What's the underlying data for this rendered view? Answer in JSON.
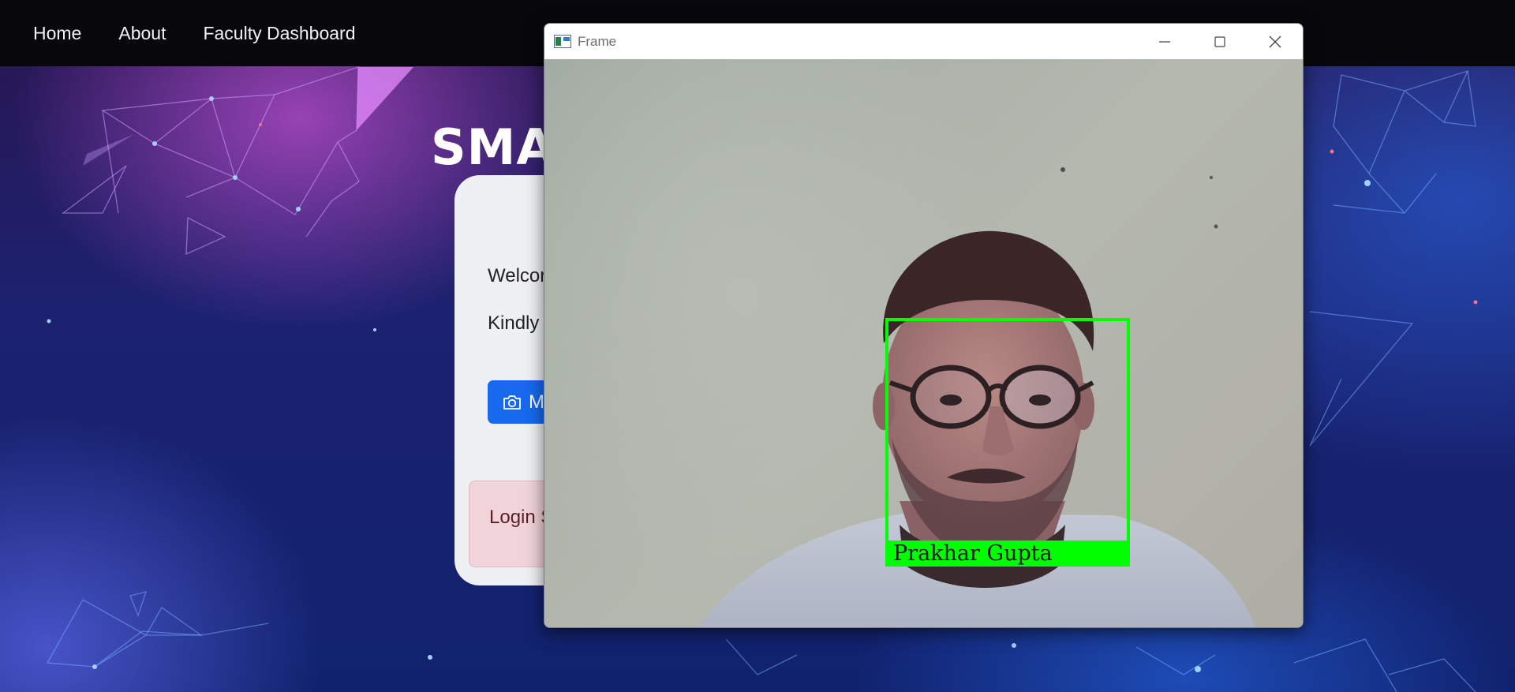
{
  "navbar": {
    "links": [
      "Home",
      "About",
      "Faculty Dashboard"
    ]
  },
  "page": {
    "title": "SMAR",
    "welcome": "Welcor",
    "kindly": "Kindly",
    "mark_button": "M",
    "alert": "Login S"
  },
  "frame_window": {
    "title": "Frame",
    "recognized_name": "Prakhar Gupta",
    "box_color": "#00ff00"
  },
  "colors": {
    "navbar_bg": "#08080c",
    "primary_button": "#1769ee",
    "alert_bg": "#f0d4d9"
  },
  "icons": [
    "camera-icon",
    "app-icon",
    "minimize-icon",
    "maximize-icon",
    "close-icon"
  ]
}
